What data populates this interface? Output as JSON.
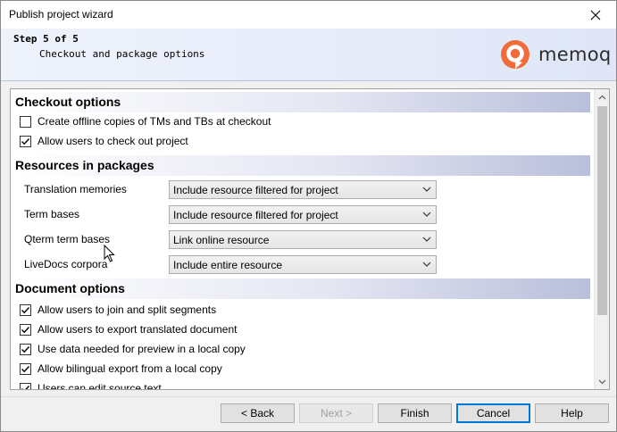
{
  "window": {
    "title": "Publish project wizard",
    "close_icon": "close-icon"
  },
  "header": {
    "step": "Step 5 of 5",
    "subtitle": "Checkout and package options",
    "logo_text": "memoq",
    "logo_color": "#f26b3a"
  },
  "checkout": {
    "heading": "Checkout options",
    "items": [
      {
        "label": "Create offline copies of TMs and TBs at checkout",
        "checked": false
      },
      {
        "label": "Allow users to check out project",
        "checked": true
      }
    ]
  },
  "resources": {
    "heading": "Resources in packages",
    "rows": [
      {
        "label": "Translation memories",
        "value": "Include resource filtered for project"
      },
      {
        "label": "Term bases",
        "value": "Include resource filtered for project"
      },
      {
        "label": "Qterm term bases",
        "value": "Link online resource"
      },
      {
        "label": "LiveDocs corpora",
        "value": "Include entire resource"
      }
    ]
  },
  "document": {
    "heading": "Document options",
    "items": [
      {
        "label": "Allow users to join and split segments",
        "checked": true
      },
      {
        "label": "Allow users to export translated document",
        "checked": true
      },
      {
        "label": "Use data needed for preview in a local copy",
        "checked": true
      },
      {
        "label": "Allow bilingual export from a local copy",
        "checked": true
      },
      {
        "label": "Users can edit source text",
        "checked": true
      }
    ]
  },
  "buttons": {
    "back": "< Back",
    "next": "Next >",
    "finish": "Finish",
    "cancel": "Cancel",
    "help": "Help"
  }
}
